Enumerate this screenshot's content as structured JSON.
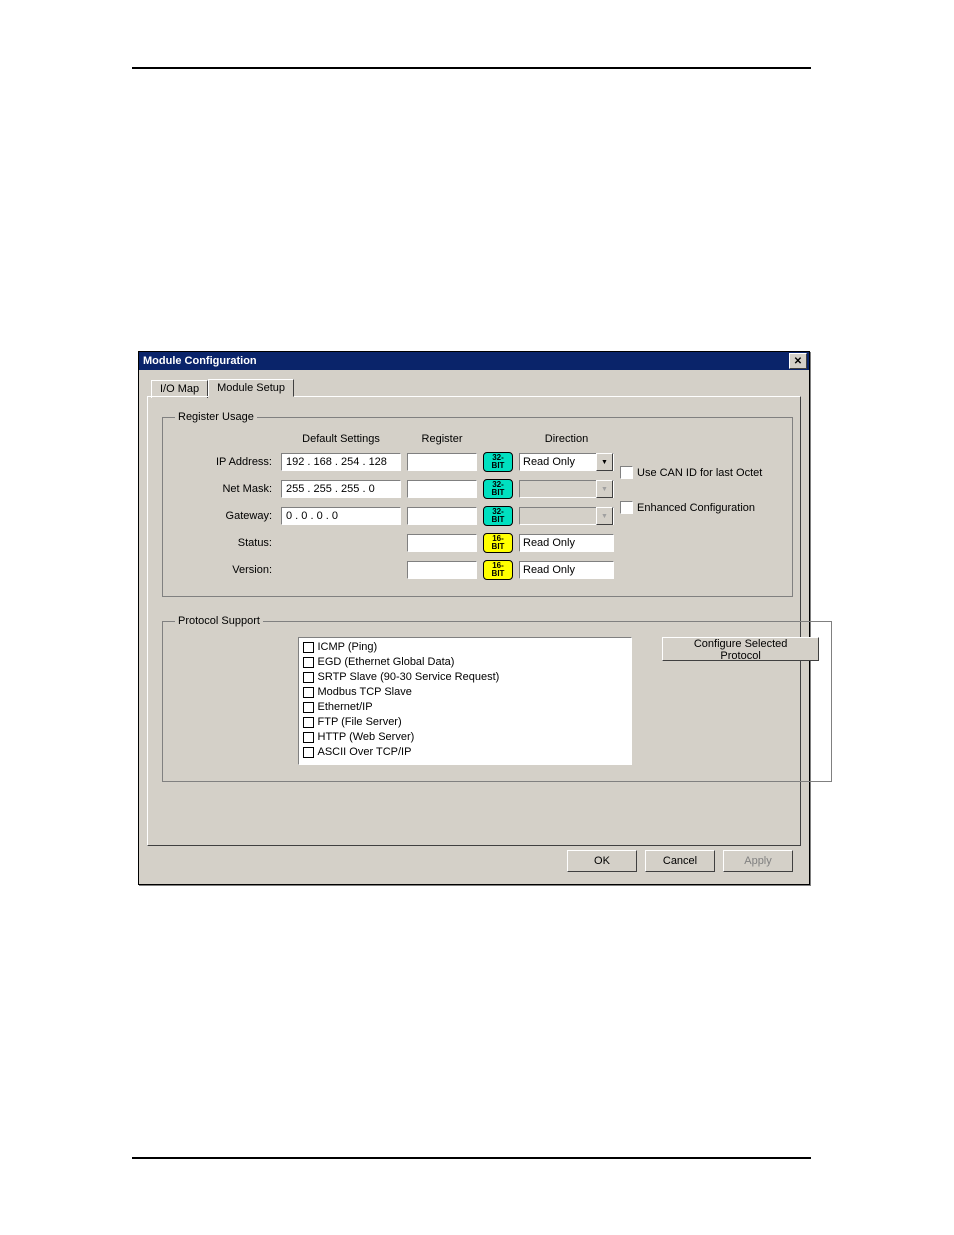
{
  "dialog": {
    "title": "Module Configuration",
    "tabs": {
      "io_map": "I/O Map",
      "module_setup": "Module Setup"
    },
    "register_usage": {
      "legend": "Register Usage",
      "headers": {
        "default": "Default Settings",
        "register": "Register",
        "direction": "Direction"
      },
      "rows": {
        "ip": {
          "label": "IP Address:",
          "value": "192 . 168 . 254 . 128",
          "bits": "32-BIT",
          "direction": "Read Only",
          "dd_enabled": true
        },
        "mask": {
          "label": "Net Mask:",
          "value": "255 . 255 . 255 .   0",
          "bits": "32-BIT",
          "direction": "",
          "dd_enabled": false
        },
        "gateway": {
          "label": "Gateway:",
          "value": "0  .   0  .   0  .   0",
          "bits": "32-BIT",
          "direction": "",
          "dd_enabled": false
        },
        "status": {
          "label": "Status:",
          "value": "",
          "bits": "16-BIT",
          "direction": "Read Only",
          "dd_enabled": false,
          "plain": true
        },
        "version": {
          "label": "Version:",
          "value": "",
          "bits": "16-BIT",
          "direction": "Read Only",
          "dd_enabled": false,
          "plain": true
        }
      },
      "checkboxes": {
        "use_can": "Use CAN ID for last Octet",
        "enhanced": "Enhanced Configuration"
      }
    },
    "protocol_support": {
      "legend": "Protocol Support",
      "items": [
        "ICMP (Ping)",
        "EGD (Ethernet Global Data)",
        "SRTP Slave (90-30 Service Request)",
        "Modbus TCP Slave",
        "Ethernet/IP",
        "FTP (File Server)",
        "HTTP (Web Server)",
        "ASCII Over TCP/IP"
      ],
      "configure_btn": "Configure Selected Protocol"
    },
    "buttons": {
      "ok": "OK",
      "cancel": "Cancel",
      "apply": "Apply"
    }
  }
}
